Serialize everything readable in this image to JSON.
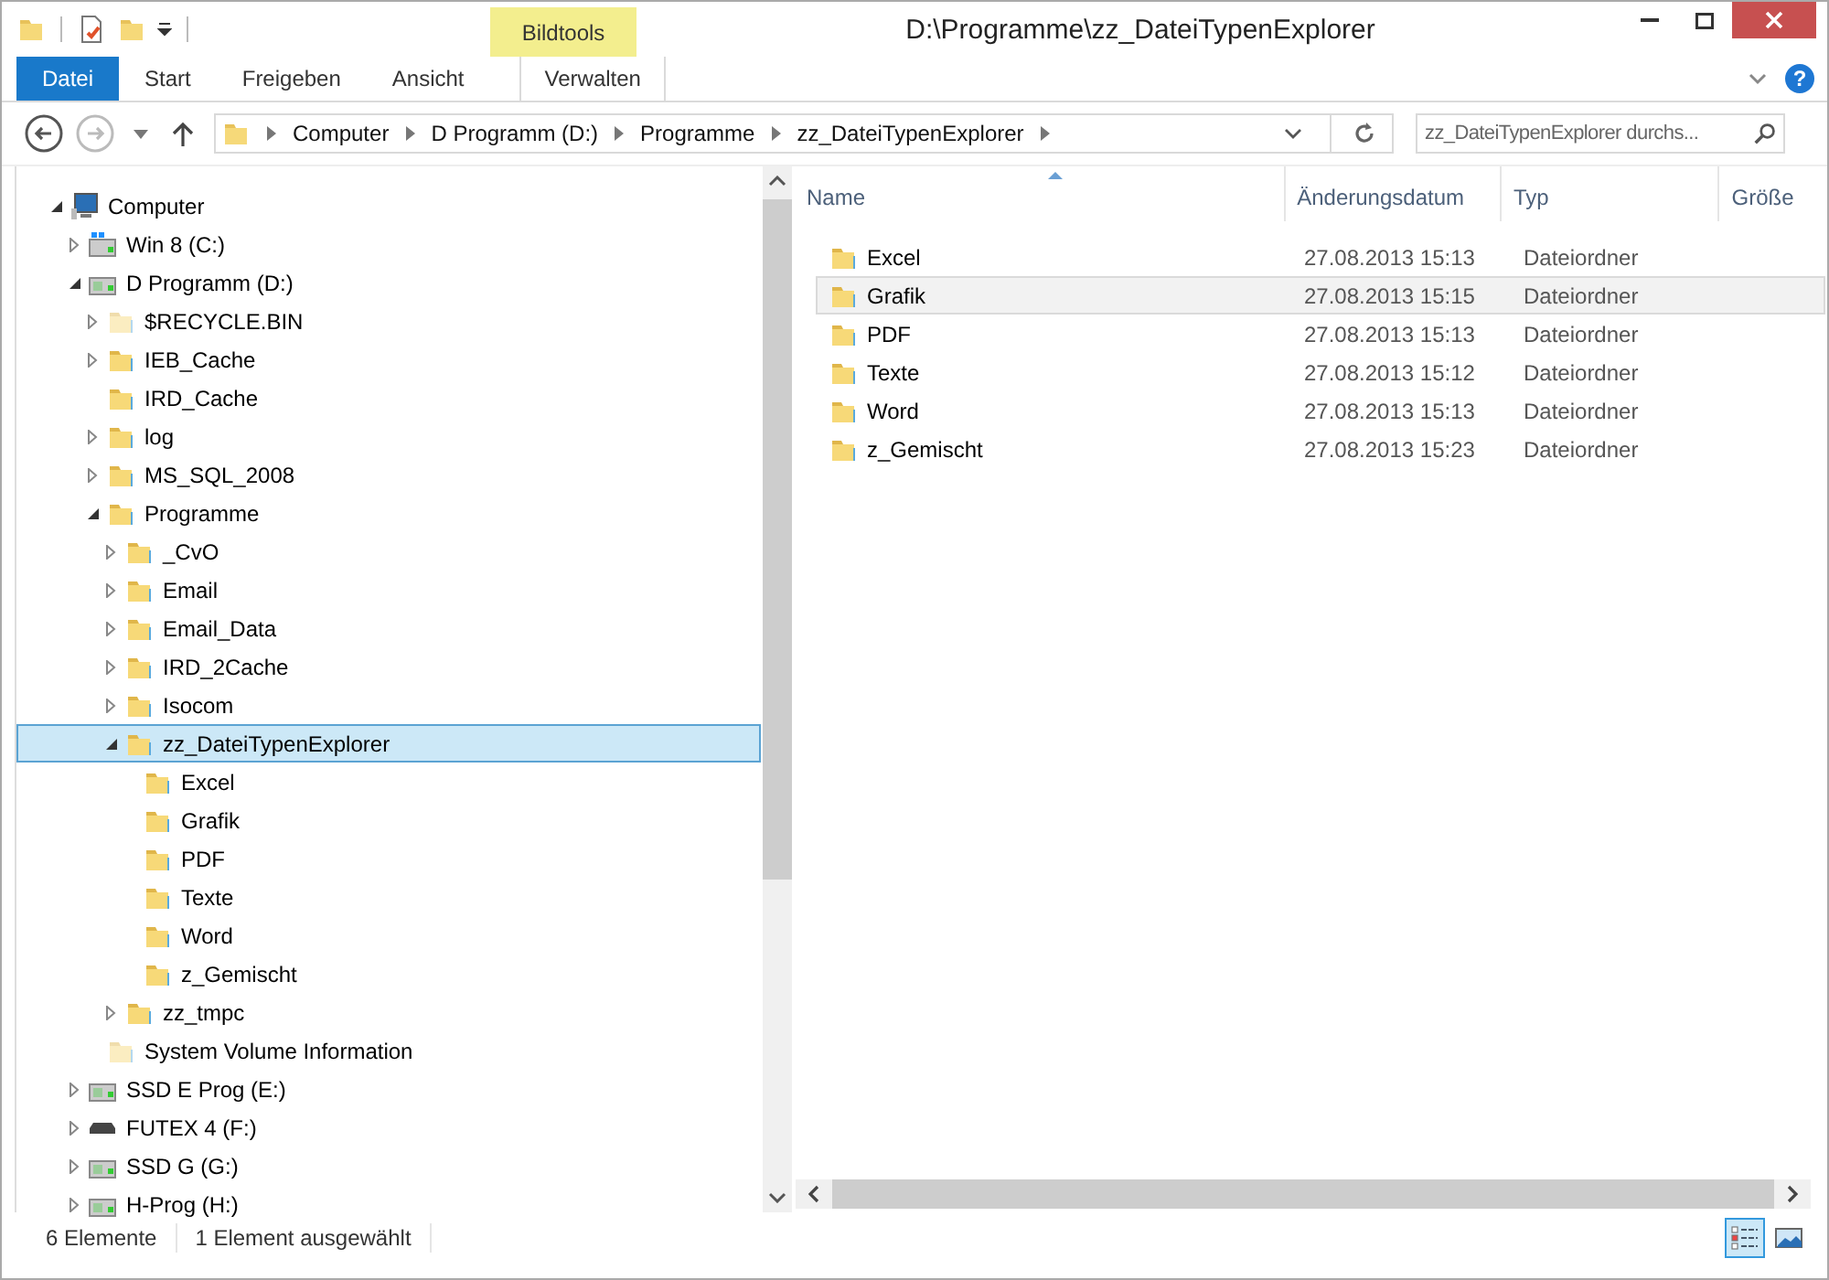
{
  "window": {
    "title": "D:\\Programme\\zz_DateiTypenExplorer"
  },
  "ribbon": {
    "context_group": "Bildtools",
    "tabs": [
      {
        "label": "Datei",
        "kind": "file",
        "selected": false
      },
      {
        "label": "Start",
        "kind": "tab",
        "selected": false
      },
      {
        "label": "Freigeben",
        "kind": "tab",
        "selected": false
      },
      {
        "label": "Ansicht",
        "kind": "tab",
        "selected": false
      },
      {
        "label": "Verwalten",
        "kind": "context",
        "selected": false
      }
    ]
  },
  "help_button": {
    "label": "?"
  },
  "navigation": {
    "back_enabled": true,
    "forward_enabled": false
  },
  "address_bar": {
    "crumbs": [
      "Computer",
      "D Programm (D:)",
      "Programme",
      "zz_DateiTypenExplorer"
    ]
  },
  "search": {
    "placeholder": "zz_DateiTypenExplorer durchs..."
  },
  "tree": [
    {
      "label": "Computer",
      "kind": "computer",
      "expandable": true,
      "expanded": true,
      "selected": false,
      "children": [
        {
          "label": "Win 8 (C:)",
          "kind": "system_drive",
          "expandable": true,
          "expanded": false,
          "selected": false
        },
        {
          "label": "D Programm (D:)",
          "kind": "drive",
          "expandable": true,
          "expanded": true,
          "selected": false,
          "children": [
            {
              "label": "$RECYCLE.BIN",
              "kind": "hidden_folder",
              "expandable": true,
              "expanded": false,
              "selected": false
            },
            {
              "label": "IEB_Cache",
              "kind": "folder",
              "expandable": true,
              "expanded": false,
              "selected": false
            },
            {
              "label": "IRD_Cache",
              "kind": "folder",
              "expandable": false,
              "expanded": false,
              "selected": false
            },
            {
              "label": "log",
              "kind": "folder",
              "expandable": true,
              "expanded": false,
              "selected": false
            },
            {
              "label": "MS_SQL_2008",
              "kind": "folder",
              "expandable": true,
              "expanded": false,
              "selected": false
            },
            {
              "label": "Programme",
              "kind": "folder",
              "expandable": true,
              "expanded": true,
              "selected": false,
              "children": [
                {
                  "label": "_CvO",
                  "kind": "folder",
                  "expandable": true,
                  "expanded": false,
                  "selected": false
                },
                {
                  "label": "Email",
                  "kind": "folder",
                  "expandable": true,
                  "expanded": false,
                  "selected": false
                },
                {
                  "label": "Email_Data",
                  "kind": "folder",
                  "expandable": true,
                  "expanded": false,
                  "selected": false
                },
                {
                  "label": "IRD_2Cache",
                  "kind": "folder",
                  "expandable": true,
                  "expanded": false,
                  "selected": false
                },
                {
                  "label": "Isocom",
                  "kind": "folder",
                  "expandable": true,
                  "expanded": false,
                  "selected": false
                },
                {
                  "label": "zz_DateiTypenExplorer",
                  "kind": "folder",
                  "expandable": true,
                  "expanded": true,
                  "selected": true,
                  "children": [
                    {
                      "label": "Excel",
                      "kind": "folder",
                      "expandable": false,
                      "expanded": false,
                      "selected": false
                    },
                    {
                      "label": "Grafik",
                      "kind": "folder",
                      "expandable": false,
                      "expanded": false,
                      "selected": false
                    },
                    {
                      "label": "PDF",
                      "kind": "folder",
                      "expandable": false,
                      "expanded": false,
                      "selected": false
                    },
                    {
                      "label": "Texte",
                      "kind": "folder",
                      "expandable": false,
                      "expanded": false,
                      "selected": false
                    },
                    {
                      "label": "Word",
                      "kind": "folder",
                      "expandable": false,
                      "expanded": false,
                      "selected": false
                    },
                    {
                      "label": "z_Gemischt",
                      "kind": "folder",
                      "expandable": false,
                      "expanded": false,
                      "selected": false
                    }
                  ]
                },
                {
                  "label": "zz_tmpc",
                  "kind": "folder",
                  "expandable": true,
                  "expanded": false,
                  "selected": false
                }
              ]
            },
            {
              "label": "System Volume Information",
              "kind": "hidden_folder",
              "expandable": false,
              "expanded": false,
              "selected": false
            }
          ]
        },
        {
          "label": "SSD E Prog (E:)",
          "kind": "drive",
          "expandable": true,
          "expanded": false,
          "selected": false
        },
        {
          "label": "FUTEX 4 (F:)",
          "kind": "usb_drive",
          "expandable": true,
          "expanded": false,
          "selected": false
        },
        {
          "label": "SSD G (G:)",
          "kind": "drive",
          "expandable": true,
          "expanded": false,
          "selected": false
        },
        {
          "label": "H-Prog (H:)",
          "kind": "drive",
          "expandable": true,
          "expanded": false,
          "selected": false
        }
      ]
    }
  ],
  "list": {
    "columns": [
      "Name",
      "Änderungsdatum",
      "Typ",
      "Größe"
    ],
    "rows": [
      {
        "name": "Excel",
        "date": "27.08.2013 15:13",
        "type": "Dateiordner",
        "selected": false
      },
      {
        "name": "Grafik",
        "date": "27.08.2013 15:15",
        "type": "Dateiordner",
        "selected": true
      },
      {
        "name": "PDF",
        "date": "27.08.2013 15:13",
        "type": "Dateiordner",
        "selected": false
      },
      {
        "name": "Texte",
        "date": "27.08.2013 15:12",
        "type": "Dateiordner",
        "selected": false
      },
      {
        "name": "Word",
        "date": "27.08.2013 15:13",
        "type": "Dateiordner",
        "selected": false
      },
      {
        "name": "z_Gemischt",
        "date": "27.08.2013 15:23",
        "type": "Dateiordner",
        "selected": false
      }
    ]
  },
  "status_bar": {
    "count": "6 Elemente",
    "selection": "1 Element ausgewählt"
  },
  "view_buttons": [
    {
      "kind": "details",
      "selected": true
    },
    {
      "kind": "large_icons",
      "selected": false
    }
  ]
}
